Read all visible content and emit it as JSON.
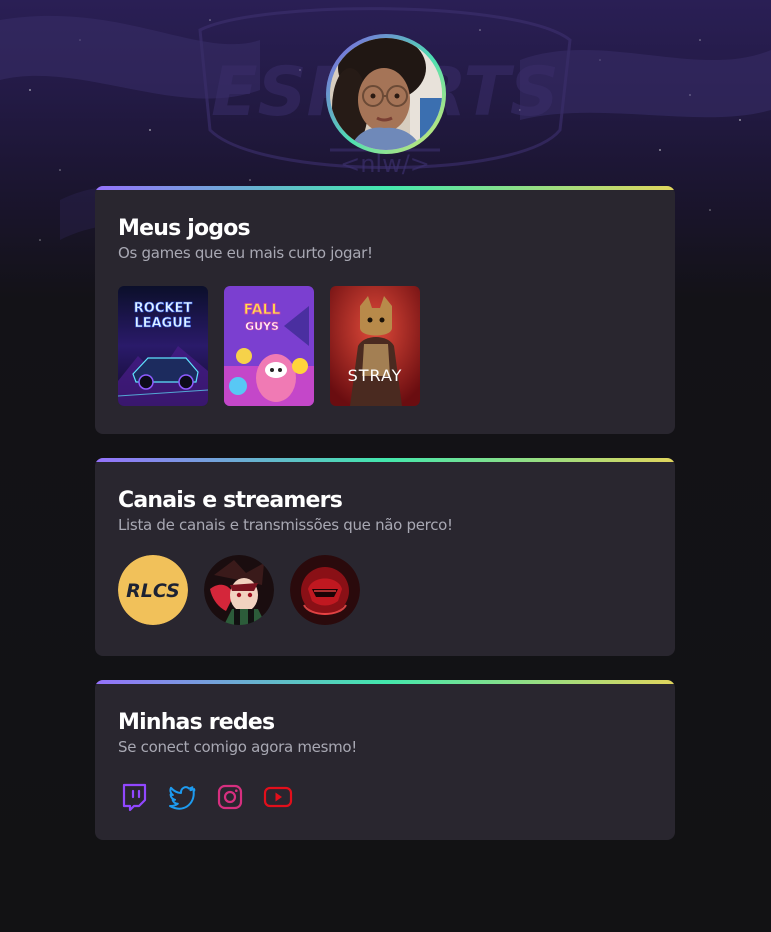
{
  "profile": {
    "avatar_alt": "Foto de perfil"
  },
  "games_card": {
    "title": "Meus jogos",
    "subtitle": "Os games que eu mais curto jogar!",
    "games": [
      {
        "name": "Rocket League",
        "logo_line1": "ROCKET",
        "logo_line2": "LEAGUE"
      },
      {
        "name": "Fall Guys",
        "logo_line1": "FALL",
        "logo_line2": "GUYS"
      },
      {
        "name": "Stray",
        "logo_line1": "STRAY"
      }
    ]
  },
  "channels_card": {
    "title": "Canais e streamers",
    "subtitle": "Lista de canais e transmissões que não perco!",
    "channels": [
      {
        "name": "RLCS",
        "label": "RLCS"
      },
      {
        "name": "anime-streamer"
      },
      {
        "name": "red-helmet-streamer"
      }
    ]
  },
  "social_card": {
    "title": "Minhas redes",
    "subtitle": "Se conect comigo agora mesmo!",
    "networks": [
      {
        "name": "twitch-icon",
        "color": "#9147ff"
      },
      {
        "name": "twitter-icon",
        "color": "#1d9bf0"
      },
      {
        "name": "instagram-icon",
        "color": "#d62f7f"
      },
      {
        "name": "youtube-icon",
        "color": "#e20f1b"
      }
    ]
  },
  "colors": {
    "background": "#121214",
    "card": "#29262f",
    "gradient_start": "#9572fc",
    "gradient_mid": "#43e7ad",
    "gradient_end": "#e1d55d"
  }
}
